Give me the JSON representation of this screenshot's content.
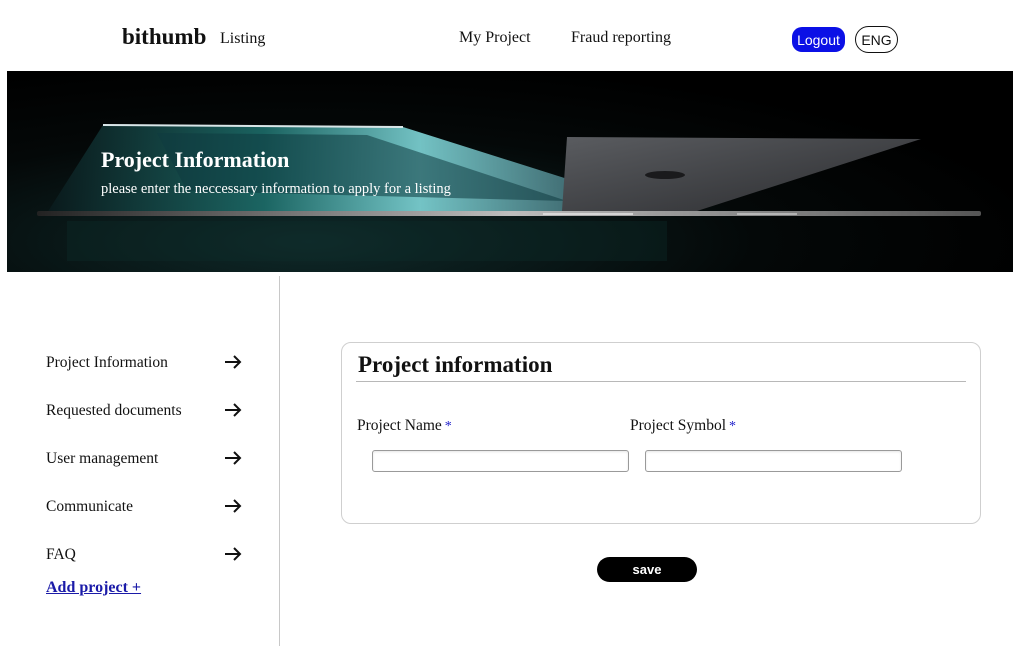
{
  "header": {
    "brand": "bithumb",
    "brand_sub": "Listing",
    "nav": [
      {
        "label": "My Project"
      },
      {
        "label": "Fraud reporting"
      }
    ],
    "logout_label": "Logout",
    "language_label": "ENG"
  },
  "hero": {
    "title": "Project Information",
    "subtitle": "please enter the neccessary information to apply for a listing"
  },
  "sidebar": {
    "items": [
      {
        "label": "Project Information",
        "icon": "arrow-right-icon"
      },
      {
        "label": "Requested documents",
        "icon": "arrow-right-icon"
      },
      {
        "label": "User management",
        "icon": "arrow-right-icon"
      },
      {
        "label": "Communicate",
        "icon": "arrow-right-icon"
      },
      {
        "label": "FAQ",
        "icon": "arrow-right-icon"
      }
    ],
    "add_project_label": "Add project +"
  },
  "form": {
    "title": "Project information",
    "fields": [
      {
        "label": "Project Name",
        "required_mark": "*",
        "value": ""
      },
      {
        "label": "Project Symbol",
        "required_mark": "*",
        "value": ""
      }
    ],
    "save_label": "save"
  },
  "colors": {
    "accent": "#0b10e6",
    "link": "#1a1aa8",
    "required": "#2222cc"
  }
}
